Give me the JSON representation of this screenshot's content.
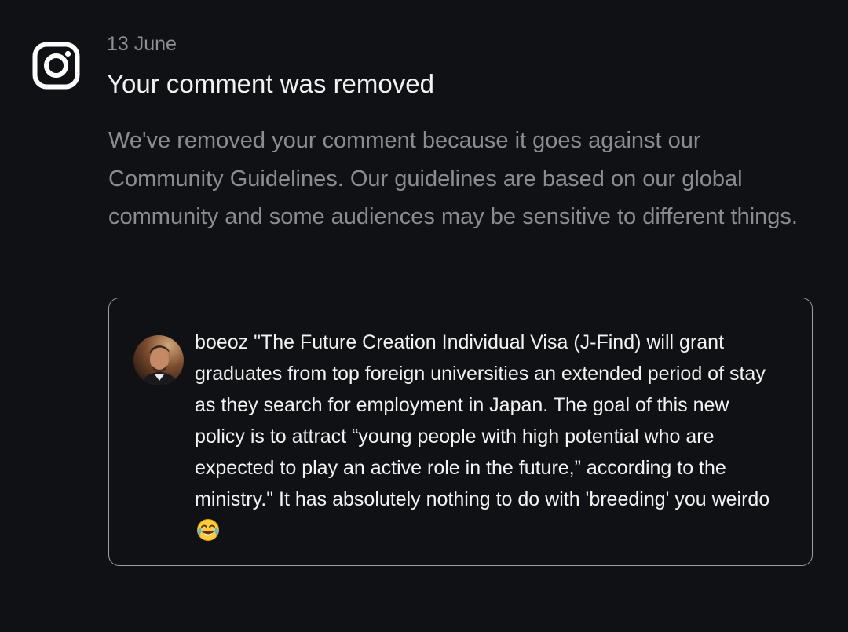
{
  "notification": {
    "app_icon": "instagram-icon",
    "date": "13 June",
    "title": "Your comment was removed",
    "message": "We've removed your comment because it goes against our Community Guidelines. Our guidelines are based on our global community and some audiences may be sensitive to different things."
  },
  "comment": {
    "username": "boeoz",
    "text": "\"The Future Creation Individual Visa (J-Find) will grant graduates from top foreign universities an extended period of stay as they search for employment in Japan. The goal of this new policy is to attract “young people with high potential who are expected to play an active role in the future,” according to the ministry.\" It has absolutely nothing to do with 'breeding' you weirdo",
    "emoji": "face-with-tears-of-joy-icon"
  }
}
